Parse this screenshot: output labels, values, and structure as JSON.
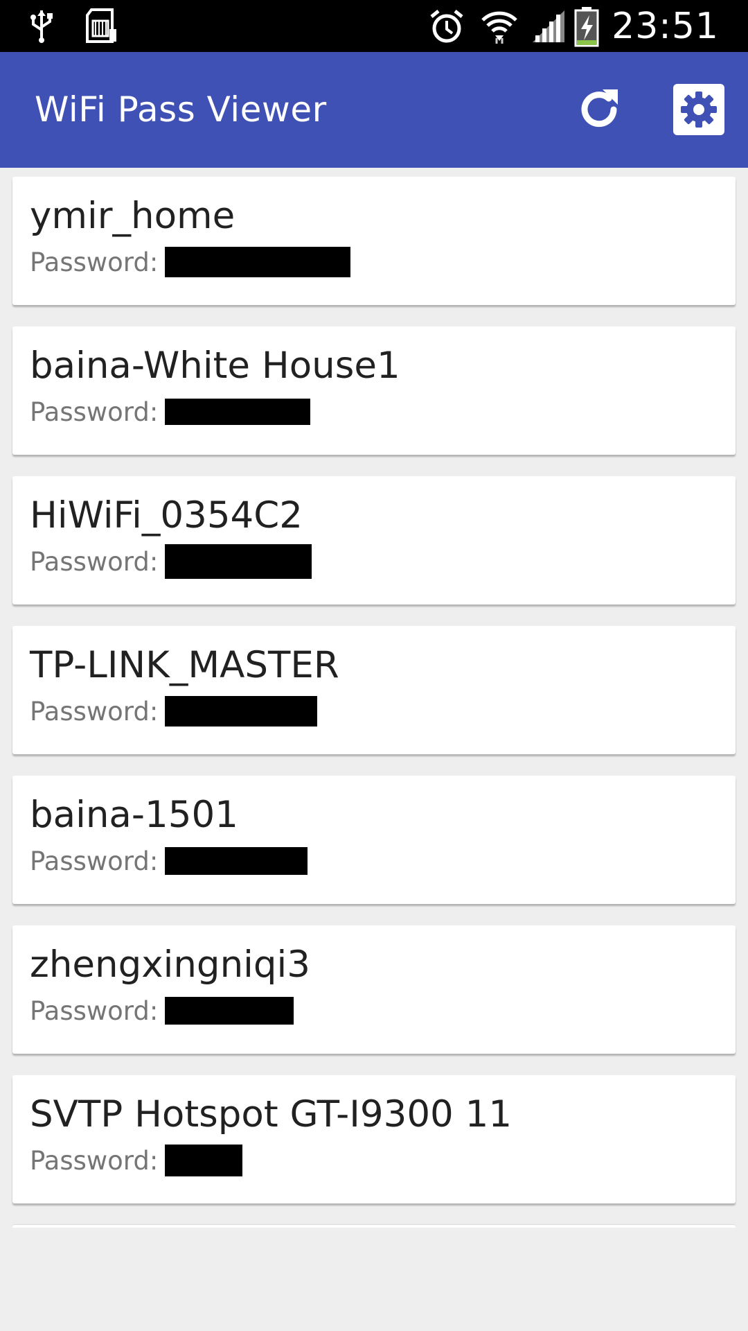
{
  "status_bar": {
    "time": "23:51",
    "left_icons": [
      "usb-icon",
      "sd-card-icon"
    ],
    "right_icons": [
      "alarm-icon",
      "wifi-icon",
      "signal-icon",
      "battery-charging-icon"
    ]
  },
  "app_bar": {
    "title": "WiFi Pass Viewer",
    "actions": [
      "refresh-icon",
      "settings-icon"
    ],
    "color": "#3f51b5"
  },
  "networks": [
    {
      "ssid": "ymir_home",
      "password_label": "Password:"
    },
    {
      "ssid": "baina-White House1",
      "password_label": "Password:"
    },
    {
      "ssid": "HiWiFi_0354C2",
      "password_label": "Password:"
    },
    {
      "ssid": "TP-LINK_MASTER",
      "password_label": "Password:"
    },
    {
      "ssid": "baina-1501",
      "password_label": "Password:"
    },
    {
      "ssid": "zhengxingniqi3",
      "password_label": "Password:"
    },
    {
      "ssid": "SVTP Hotspot GT-I9300 11",
      "password_label": "Password:"
    }
  ]
}
